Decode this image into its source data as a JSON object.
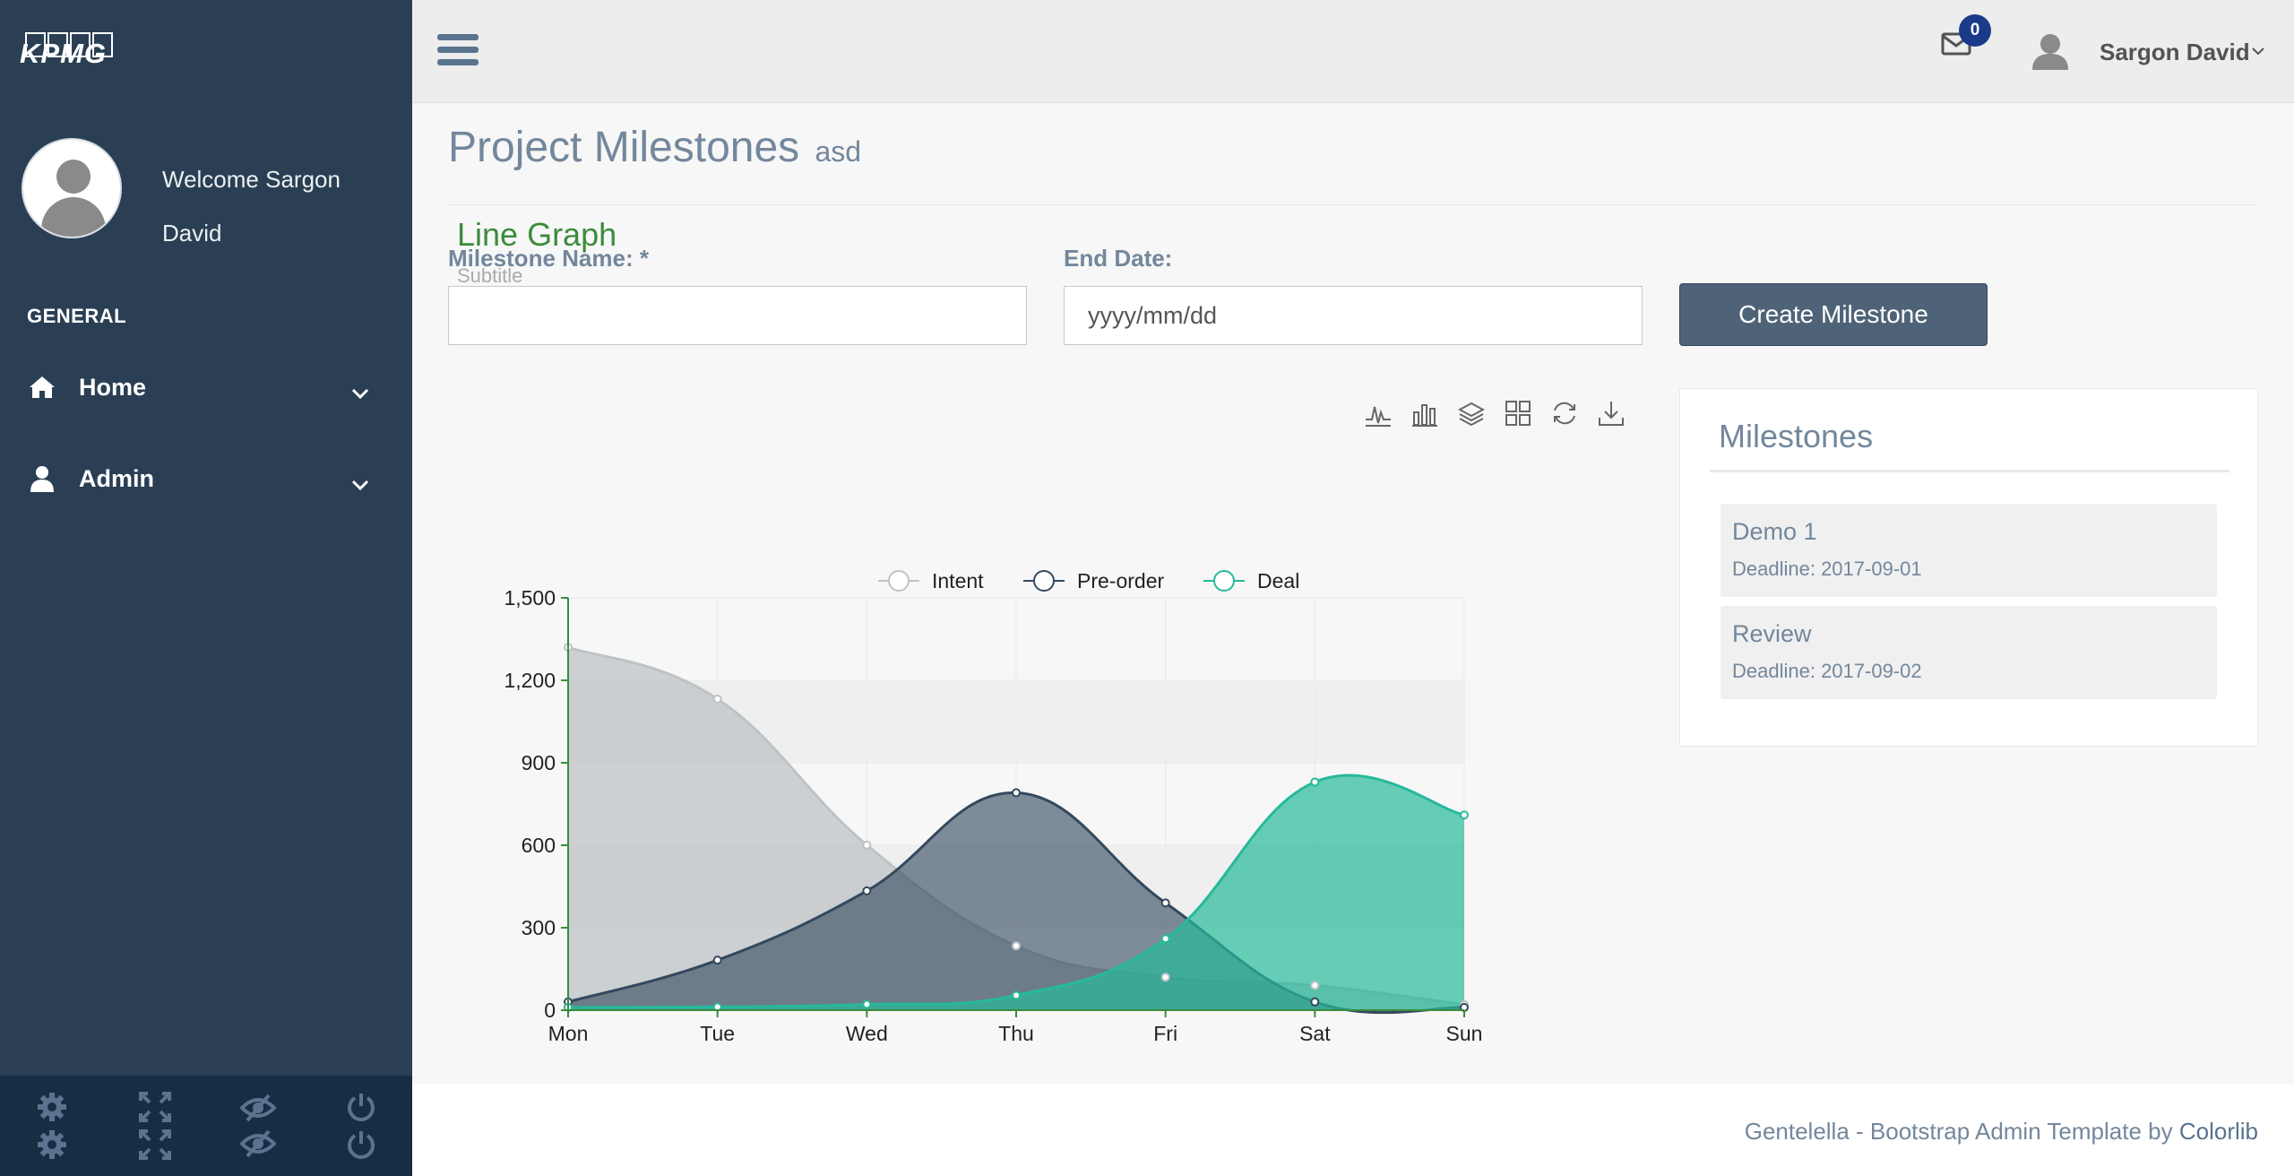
{
  "brand": {
    "logo_text": "KPMG"
  },
  "sidebar": {
    "welcome_line1": "Welcome Sargon",
    "welcome_line2": "David",
    "section_label": "GENERAL",
    "items": [
      {
        "label": "Home",
        "icon": "home-icon"
      },
      {
        "label": "Admin",
        "icon": "user-icon"
      }
    ],
    "footer_icons": [
      "gear-icon",
      "fullscreen-icon",
      "eye-slash-icon",
      "power-icon"
    ]
  },
  "topnav": {
    "mail_badge": "0",
    "user_name": "Sargon David"
  },
  "page": {
    "title": "Project Milestones",
    "subtitle": "asd"
  },
  "form": {
    "name_label": "Milestone Name: *",
    "name_value": "",
    "date_label": "End Date:",
    "date_placeholder": "yyyy/mm/dd",
    "submit_label": "Create Milestone"
  },
  "milestones": {
    "title": "Milestones",
    "items": [
      {
        "name": "Demo 1",
        "deadline": "Deadline: 2017-09-01"
      },
      {
        "name": "Review",
        "deadline": "Deadline: 2017-09-02"
      }
    ]
  },
  "toolbox_icons": [
    "line-chart-icon",
    "bar-chart-icon",
    "stack-icon",
    "tiled-icon",
    "refresh-icon",
    "download-icon"
  ],
  "chart_data": {
    "type": "area",
    "title": "Line Graph",
    "subtitle": "Subtitle",
    "categories": [
      "Mon",
      "Tue",
      "Wed",
      "Thu",
      "Fri",
      "Sat",
      "Sun"
    ],
    "ylim": [
      0,
      1500
    ],
    "yticks": [
      "0",
      "300",
      "600",
      "900",
      "1,200",
      "1,500"
    ],
    "legend_position": "top",
    "grid": true,
    "series": [
      {
        "name": "Intent",
        "values": [
          1320,
          1132,
          601,
          234,
          120,
          90,
          20
        ],
        "color": "#bdc3c7"
      },
      {
        "name": "Pre-order",
        "values": [
          30,
          182,
          434,
          791,
          390,
          30,
          10
        ],
        "color": "#34495e"
      },
      {
        "name": "Deal",
        "values": [
          10,
          12,
          21,
          54,
          260,
          830,
          710
        ],
        "color": "#26b99a"
      }
    ]
  },
  "footer": {
    "text": "Gentelella - Bootstrap Admin Template by",
    "link": "Colorlib"
  }
}
